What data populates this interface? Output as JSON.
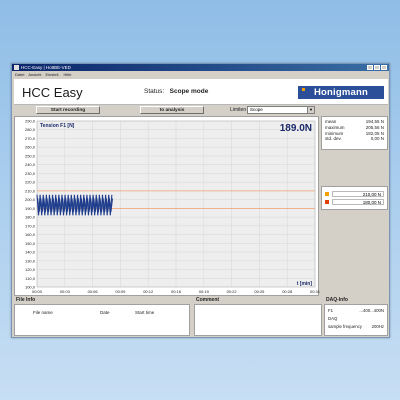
{
  "window": {
    "title": "HCC-Easy | HottBE-VED",
    "menu": [
      "Datei",
      "Ansicht",
      "Einstell.",
      "Hilfe"
    ]
  },
  "header": {
    "app_title": "HCC Easy",
    "status_label": "Status:",
    "status_value": "Scope mode",
    "logo": "Honigmann"
  },
  "toolbar": {
    "start_recording": "Start recording",
    "to_analysis": "to analysis",
    "limits_label": "Limiten",
    "limits_selected": "Scope"
  },
  "chart": {
    "series_label": "Tension F1 [N]",
    "current_value": "189.0N",
    "x_axis_label": "t [min]"
  },
  "chart_data": {
    "type": "line",
    "ylabel": "Tension F1 [N]",
    "xlabel": "t [min]",
    "ylim": [
      100,
      290
    ],
    "y_ticks": [
      "290,0",
      "280,0",
      "270,0",
      "260,0",
      "250,0",
      "240,0",
      "230,0",
      "220,0",
      "210,0",
      "200,0",
      "190,0",
      "180,0",
      "170,0",
      "160,0",
      "150,0",
      "140,0",
      "130,0",
      "120,0",
      "110,0",
      "100,0"
    ],
    "x_ticks": [
      "00:00",
      "00:03",
      "00:06",
      "00:09",
      "00:12",
      "00:16",
      "00:19",
      "00:22",
      "00:25",
      "00:28",
      "00:31"
    ],
    "x_range_min": [
      0,
      0.52
    ],
    "limit_lines": [
      {
        "name": "upper limit",
        "value": 210.0,
        "color": "#f0a070"
      },
      {
        "name": "lower limit",
        "value": 190.0,
        "color": "#f0a070"
      }
    ],
    "series": [
      {
        "name": "Tension F1",
        "color": "#1f3d8c",
        "x_min": [
          0.0,
          0.14
        ],
        "oscillation": {
          "center": 190.0,
          "min": 182.0,
          "max": 205.5,
          "cycles": 24
        }
      }
    ]
  },
  "stats": [
    {
      "label": "mean",
      "value": "194,55 N"
    },
    {
      "label": "maximum",
      "value": "205,56 N"
    },
    {
      "label": "minimum",
      "value": "182,05 N"
    },
    {
      "label": "std. dev.",
      "value": "0,00 N"
    }
  ],
  "limits": [
    {
      "value": "210,00 N",
      "color": "#f0a000"
    },
    {
      "value": "180,00 N",
      "color": "#e04000"
    }
  ],
  "bottom": {
    "file_info_title": "File Info",
    "comment_title": "Comment",
    "daq_title": "DAQ-Info",
    "columns": [
      "File name",
      "Date",
      "Start time"
    ],
    "daq": [
      {
        "label": "F1",
        "value": "...400...400N"
      },
      {
        "label": "DAQ",
        "value": ""
      },
      {
        "label": "sample frequency",
        "value": "200Hz"
      }
    ]
  }
}
